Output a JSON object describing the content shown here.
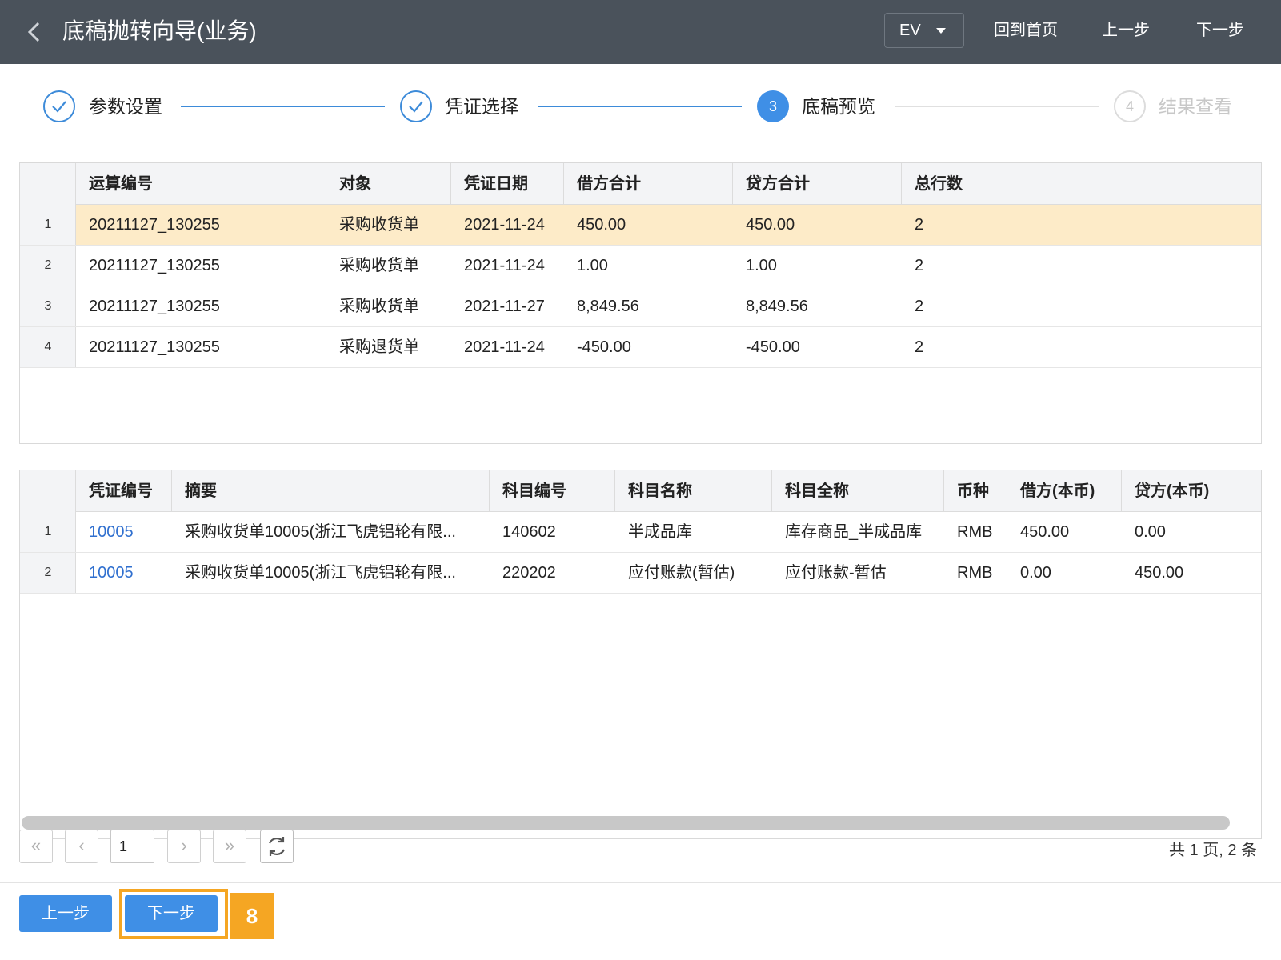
{
  "header": {
    "title": "底稿抛转向导(业务)",
    "ev_label": "EV",
    "home_label": "回到首页",
    "prev_label": "上一步",
    "next_label": "下一步"
  },
  "steps": [
    {
      "label": "参数设置",
      "state": "done"
    },
    {
      "label": "凭证选择",
      "state": "done"
    },
    {
      "label": "底稿预览",
      "state": "active",
      "number": "3"
    },
    {
      "label": "结果查看",
      "state": "pending",
      "number": "4"
    }
  ],
  "top_grid": {
    "columns": [
      "运算编号",
      "对象",
      "凭证日期",
      "借方合计",
      "贷方合计",
      "总行数"
    ],
    "rows": [
      {
        "num": "1",
        "calc_no": "20211127_130255",
        "object": "采购收货单",
        "date": "2021-11-24",
        "debit": "450.00",
        "credit": "450.00",
        "lines": "2"
      },
      {
        "num": "2",
        "calc_no": "20211127_130255",
        "object": "采购收货单",
        "date": "2021-11-24",
        "debit": "1.00",
        "credit": "1.00",
        "lines": "2"
      },
      {
        "num": "3",
        "calc_no": "20211127_130255",
        "object": "采购收货单",
        "date": "2021-11-27",
        "debit": "8,849.56",
        "credit": "8,849.56",
        "lines": "2"
      },
      {
        "num": "4",
        "calc_no": "20211127_130255",
        "object": "采购退货单",
        "date": "2021-11-24",
        "debit": "-450.00",
        "credit": "-450.00",
        "lines": "2"
      }
    ]
  },
  "bottom_grid": {
    "columns": [
      "凭证编号",
      "摘要",
      "科目编号",
      "科目名称",
      "科目全称",
      "币种",
      "借方(本币)",
      "贷方(本币)"
    ],
    "rows": [
      {
        "num": "1",
        "voucher": "10005",
        "summary": "采购收货单10005(浙江飞虎铝轮有限...",
        "acct_no": "140602",
        "acct_name": "半成品库",
        "acct_full": "库存商品_半成品库",
        "currency": "RMB",
        "debit": "450.00",
        "credit": "0.00"
      },
      {
        "num": "2",
        "voucher": "10005",
        "summary": "采购收货单10005(浙江飞虎铝轮有限...",
        "acct_no": "220202",
        "acct_name": "应付账款(暂估)",
        "acct_full": "应付账款-暂估",
        "currency": "RMB",
        "debit": "0.00",
        "credit": "450.00"
      }
    ]
  },
  "pager": {
    "first": "«",
    "prev": "‹",
    "next": "›",
    "last": "»",
    "page_value": "1",
    "info": "共 1 页, 2 条"
  },
  "footer": {
    "prev_label": "上一步",
    "next_label": "下一步",
    "badge": "8"
  },
  "colors": {
    "header_bg": "#4a525b",
    "accent": "#3f8fe6",
    "selected_row": "#fdebc8",
    "highlight": "#f5a623",
    "link": "#2f6fcf"
  }
}
